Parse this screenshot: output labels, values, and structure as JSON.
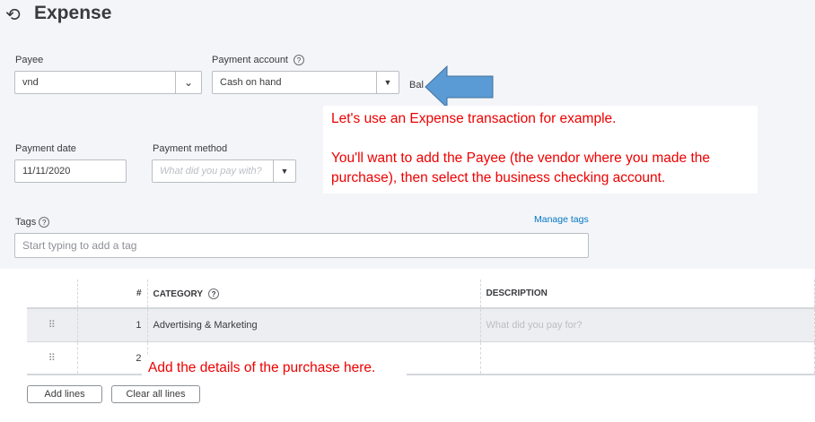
{
  "title": "Expense",
  "payee": {
    "label": "Payee",
    "value": "vnd"
  },
  "payment_account": {
    "label": "Payment account",
    "value": "Cash on hand",
    "balance_label": "Bal"
  },
  "payment_date": {
    "label": "Payment date",
    "value": "11/11/2020"
  },
  "payment_method": {
    "label": "Payment method",
    "placeholder": "What did you pay with?"
  },
  "tags": {
    "label": "Tags",
    "placeholder": "Start typing to add a tag",
    "manage": "Manage tags"
  },
  "table": {
    "headers": [
      "#",
      "CATEGORY",
      "DESCRIPTION"
    ],
    "rows": [
      {
        "num": "1",
        "category": "Advertising & Marketing",
        "description_placeholder": "What did you pay for?"
      },
      {
        "num": "2",
        "category": "",
        "description_placeholder": ""
      }
    ]
  },
  "buttons": {
    "add_lines": "Add lines",
    "clear_all": "Clear all lines"
  },
  "notes": {
    "line1": "Let's use an Expense transaction for example.",
    "line2": "You'll want to add the Payee (the vendor where you made the purchase), then select the business checking account.",
    "details": "Add the details of the purchase here."
  },
  "colors": {
    "note": "#ee0000",
    "arrow": "#5b9bd5"
  }
}
